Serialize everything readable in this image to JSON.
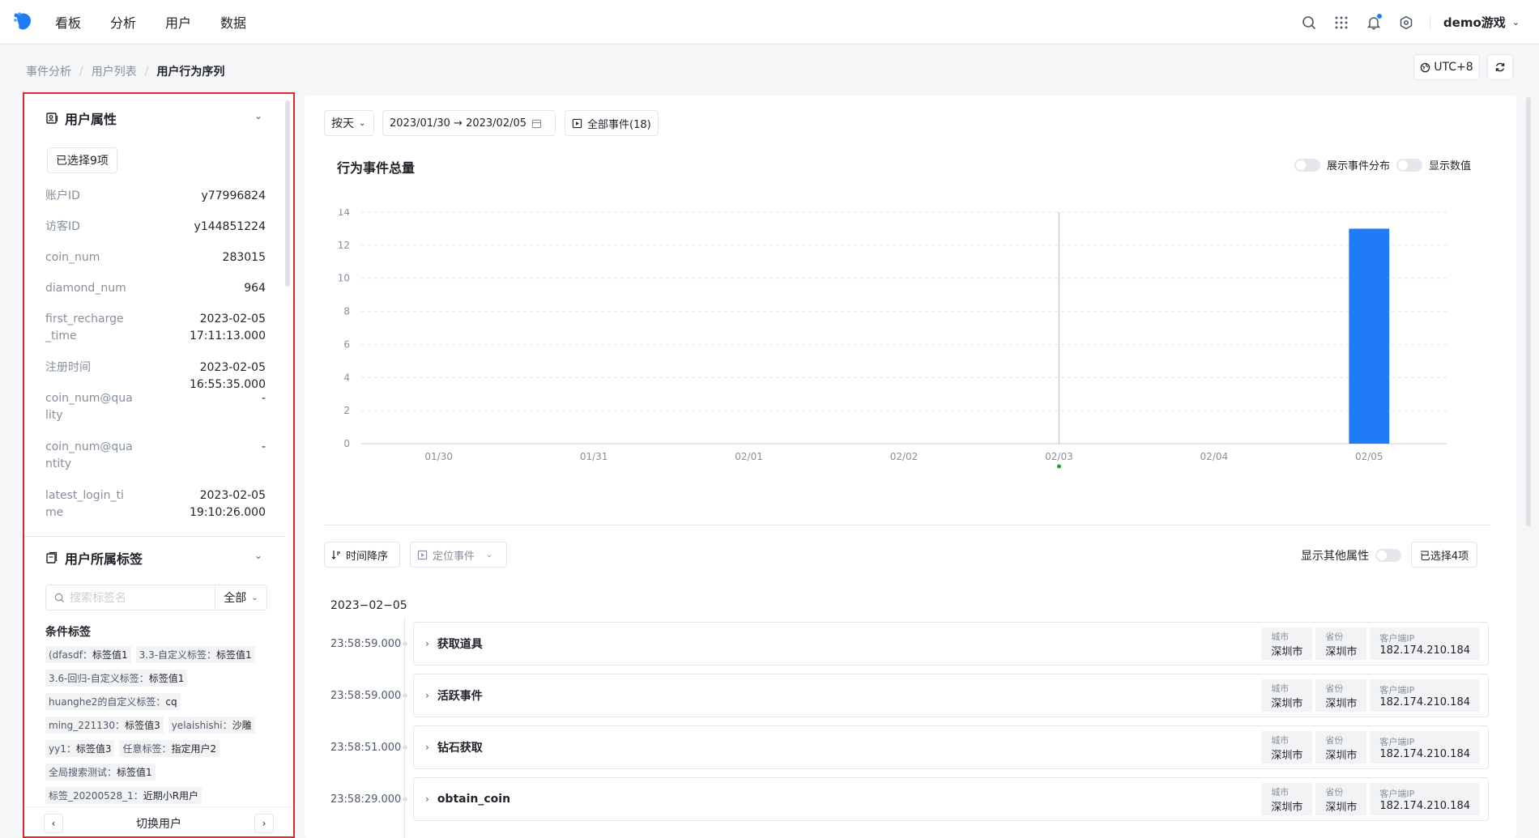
{
  "nav": {
    "items": [
      "看板",
      "分析",
      "用户",
      "数据"
    ],
    "project": "demo游戏"
  },
  "breadcrumb": [
    "事件分析",
    "用户列表",
    "用户行为序列"
  ],
  "timezone": "UTC+8",
  "user_props": {
    "title": "用户属性",
    "selected": "已选择9项",
    "rows": [
      {
        "key": "账户ID",
        "value": "y77996824"
      },
      {
        "key": "访客ID",
        "value": "y144851224"
      },
      {
        "key": "coin_num",
        "value": "283015"
      },
      {
        "key": "diamond_num",
        "value": "964"
      },
      {
        "key": "first_recharge_time",
        "value": "2023-02-05 17:11:13.000"
      },
      {
        "key": "注册时间",
        "value": "2023-02-05 16:55:35.000"
      },
      {
        "key": "coin_num@quality",
        "value": "-"
      },
      {
        "key": "coin_num@quantity",
        "value": "-"
      },
      {
        "key": "latest_login_time",
        "value": "2023-02-05 19:10:26.000"
      }
    ]
  },
  "user_tags": {
    "title": "用户所属标签",
    "search_placeholder": "搜索标签名",
    "filter": "全部",
    "subtitle": "条件标签",
    "tags": [
      [
        {
          "k": "(dfasdf：",
          "v": "标签值1"
        },
        {
          "k": "3.3-自定义标签：",
          "v": "标签值1"
        }
      ],
      [
        {
          "k": "3.6-回归-自定义标签：",
          "v": "标签值1"
        }
      ],
      [
        {
          "k": "huanghe2的自定义标签：",
          "v": "cq"
        }
      ],
      [
        {
          "k": "ming_221130：",
          "v": "标签值3"
        },
        {
          "k": "yelaishishi：",
          "v": "沙雕"
        }
      ],
      [
        {
          "k": "yy1：",
          "v": "标签值3"
        },
        {
          "k": "任意标签：",
          "v": "指定用户2"
        }
      ],
      [
        {
          "k": "全局搜索测试：",
          "v": "标签值1"
        }
      ],
      [
        {
          "k": "标签_20200528_1：",
          "v": "近期小R用户"
        }
      ]
    ],
    "switch_label": "切换用户"
  },
  "controls": {
    "granularity": "按天",
    "date_range": "2023/01/30 → 2023/02/05",
    "all_events": "全部事件(18)"
  },
  "chart": {
    "title": "行为事件总量",
    "toggle_distribution": "展示事件分布",
    "toggle_values": "显示数值"
  },
  "chart_data": {
    "type": "bar",
    "categories": [
      "01/30",
      "01/31",
      "02/01",
      "02/02",
      "02/03",
      "02/04",
      "02/05"
    ],
    "values": [
      0,
      0,
      0,
      0,
      0,
      0,
      13
    ],
    "title": "行为事件总量",
    "xlabel": "",
    "ylabel": "",
    "ylim": [
      0,
      14
    ],
    "yticks": [
      0,
      2,
      4,
      6,
      8,
      10,
      12,
      14
    ],
    "grid": true,
    "bar_color": "#1f7cf6",
    "marker_category": "02/03"
  },
  "list_controls": {
    "sort": "时间降序",
    "locate": "定位事件",
    "show_other": "显示其他属性",
    "selected": "已选择4项"
  },
  "timeline": {
    "date": "2023−02−05",
    "events": [
      {
        "time": "23:58:59.000",
        "name": "获取道具",
        "props": [
          {
            "k": "城市",
            "v": "深圳市"
          },
          {
            "k": "省份",
            "v": "深圳市"
          },
          {
            "k": "客户端IP",
            "v": "182.174.210.184"
          }
        ]
      },
      {
        "time": "23:58:59.000",
        "name": "活跃事件",
        "props": [
          {
            "k": "城市",
            "v": "深圳市"
          },
          {
            "k": "省份",
            "v": "深圳市"
          },
          {
            "k": "客户端IP",
            "v": "182.174.210.184"
          }
        ]
      },
      {
        "time": "23:58:51.000",
        "name": "钻石获取",
        "props": [
          {
            "k": "城市",
            "v": "深圳市"
          },
          {
            "k": "省份",
            "v": "深圳市"
          },
          {
            "k": "客户端IP",
            "v": "182.174.210.184"
          }
        ]
      },
      {
        "time": "23:58:29.000",
        "name": "obtain_coin",
        "props": [
          {
            "k": "城市",
            "v": "深圳市"
          },
          {
            "k": "省份",
            "v": "深圳市"
          },
          {
            "k": "客户端IP",
            "v": "182.174.210.184"
          }
        ]
      }
    ]
  }
}
